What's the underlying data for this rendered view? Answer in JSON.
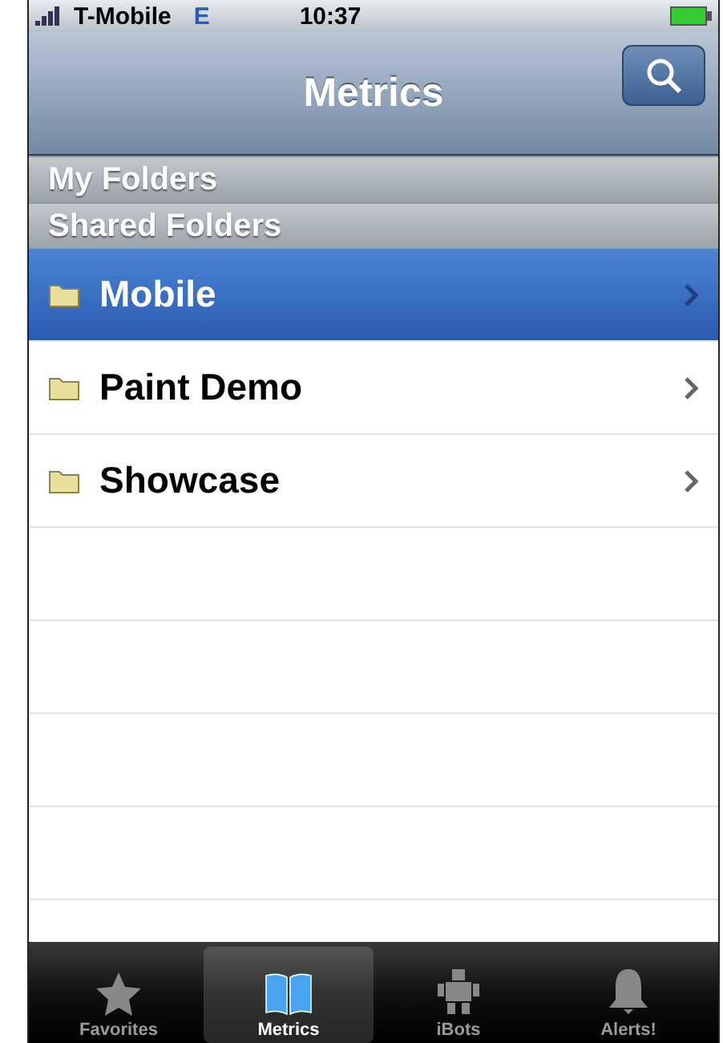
{
  "status_bar": {
    "carrier": "T-Mobile",
    "network": "E",
    "time": "10:37"
  },
  "nav_bar": {
    "title": "Metrics"
  },
  "sections": [
    {
      "label": "My Folders"
    },
    {
      "label": "Shared Folders"
    }
  ],
  "folders": [
    {
      "name": "Mobile",
      "selected": true
    },
    {
      "name": "Paint Demo",
      "selected": false
    },
    {
      "name": "Showcase",
      "selected": false
    }
  ],
  "tabs": [
    {
      "label": "Favorites",
      "kind": "star",
      "selected": false
    },
    {
      "label": "Metrics",
      "kind": "book",
      "selected": true
    },
    {
      "label": "iBots",
      "kind": "robot",
      "selected": false
    },
    {
      "label": "Alerts!",
      "kind": "bell",
      "selected": false
    }
  ]
}
